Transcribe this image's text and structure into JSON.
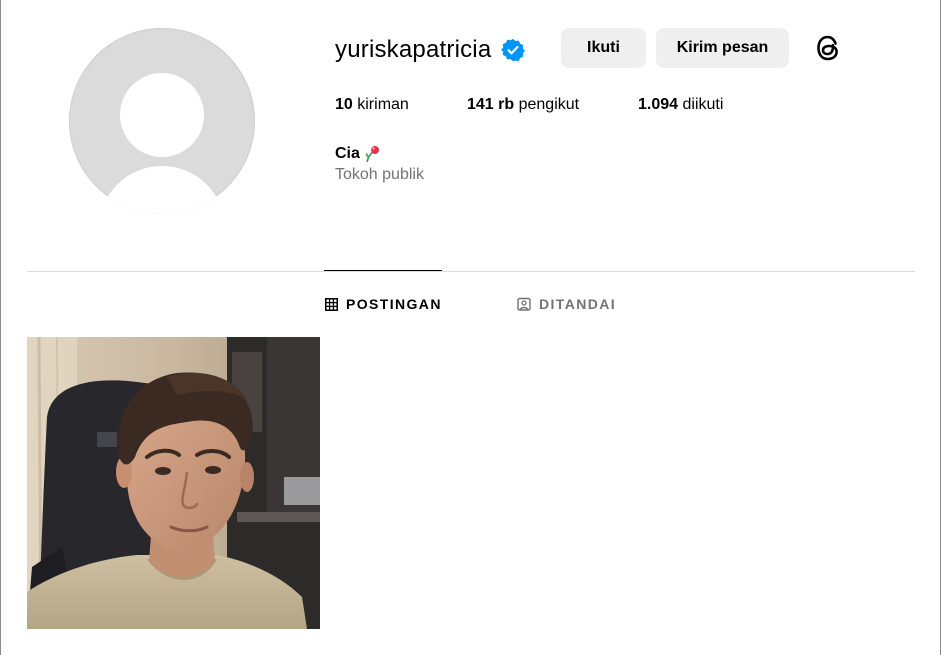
{
  "profile": {
    "username": "yuriskapatricia",
    "verified": true,
    "follow_label": "Ikuti",
    "message_label": "Kirim pesan",
    "stats": {
      "posts_count": "10",
      "posts_label": "kiriman",
      "followers_count": "141 rb",
      "followers_label": "pengikut",
      "following_count": "1.094",
      "following_label": "diikuti"
    },
    "bio_name": "Cia",
    "category": "Tokoh publik"
  },
  "tabs": [
    {
      "label": "POSTINGAN",
      "icon": "grid-icon",
      "active": true
    },
    {
      "label": "DITANDAI",
      "icon": "tagged-icon",
      "active": false
    }
  ],
  "colors": {
    "verified_badge": "#0095f6",
    "button_bg": "#efefef",
    "secondary_text": "#737373",
    "divider": "#dbdbdb"
  }
}
